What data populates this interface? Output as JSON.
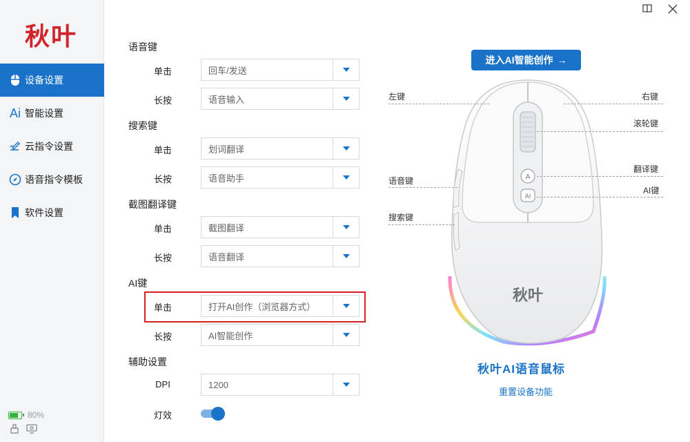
{
  "app": {
    "logo": "秋叶"
  },
  "window_controls": {
    "book": "🕮",
    "close": "✕"
  },
  "sidebar": {
    "items": [
      {
        "label": "设备设置",
        "icon": "mouse-icon"
      },
      {
        "label": "智能设置",
        "icon": "ai-icon",
        "icon_text": "Ai"
      },
      {
        "label": "云指令设置",
        "icon": "cloud-pen-icon"
      },
      {
        "label": "语音指令模板",
        "icon": "compass-icon"
      },
      {
        "label": "软件设置",
        "icon": "bookmark-icon"
      }
    ],
    "active_index": 0,
    "battery": {
      "percent_text": "80%",
      "level": 0.8,
      "color": "#34b33c"
    }
  },
  "settings": {
    "groups": [
      {
        "title": "语音键",
        "rows": [
          {
            "label": "单击",
            "value": "回车/发送"
          },
          {
            "label": "长按",
            "value": "语音输入"
          }
        ]
      },
      {
        "title": "搜索键",
        "rows": [
          {
            "label": "单击",
            "value": "划词翻译"
          },
          {
            "label": "长按",
            "value": "语音助手"
          }
        ]
      },
      {
        "title": "截图翻译键",
        "rows": [
          {
            "label": "单击",
            "value": "截图翻译"
          },
          {
            "label": "长按",
            "value": "语音翻译"
          }
        ]
      },
      {
        "title": "AI键",
        "rows": [
          {
            "label": "单击",
            "value": "打开AI创作（浏览器方式）"
          },
          {
            "label": "长按",
            "value": "AI智能创作"
          }
        ]
      },
      {
        "title": "辅助设置",
        "rows": [
          {
            "label": "DPI",
            "value": "1200"
          },
          {
            "label": "灯效",
            "toggle": true
          }
        ]
      }
    ]
  },
  "right_panel": {
    "cta_label": "进入AI智能创作",
    "cta_arrow": "→",
    "callouts": {
      "left_key": "左键",
      "right_key": "右键",
      "scroll_wheel": "滚轮键",
      "translate_key": "翻译键",
      "ai_key": "AI键",
      "voice_key": "语音键",
      "search_key": "搜索键"
    },
    "mouse_logo": "秋叶",
    "product_name": "秋叶AI语音鼠标",
    "reset_label": "重置设备功能"
  },
  "colors": {
    "accent": "#1a73c8",
    "brand_red": "#d1232a",
    "highlight": "#d71f26"
  }
}
